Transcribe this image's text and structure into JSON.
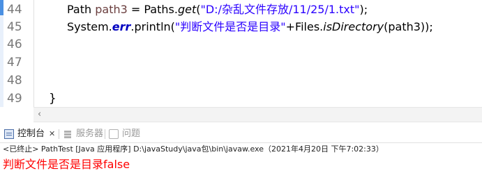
{
  "editor": {
    "line_numbers": [
      "44",
      "45",
      "46",
      "47",
      "48",
      "49"
    ],
    "line44": {
      "type": "Path ",
      "var": "path3",
      "eq": " = Paths.",
      "method": "get",
      "open": "(",
      "string": "\"D:/杂乱文件存放/11/25/1.txt\"",
      "close": ");"
    },
    "line45": {
      "prefix": "System.",
      "err": "err",
      "println": ".println(",
      "string": "\"判断文件是否是目录\"",
      "plus": "+Files.",
      "method": "isDirectory",
      "arg": "(path3));"
    },
    "closing_brace": "}"
  },
  "scrollbar": {
    "left_arrow": "‹"
  },
  "tabs": [
    {
      "label": "控制台",
      "close": "✕",
      "icon": "console-icon"
    },
    {
      "label": "服务器",
      "icon": "server-icon"
    },
    {
      "label": "问题",
      "icon": "problems-icon"
    }
  ],
  "console": {
    "status_line": "<已终止> PathTest [Java 应用程序] D:\\javaStudy\\java包\\bin\\javaw.exe（2021年4月20日 下午7:02:33）",
    "output": "判断文件是否是目录false"
  },
  "colors": {
    "string": "#2a00ff",
    "variable": "#6a3e3e",
    "field": "#0000c0",
    "stderr_output": "#ff0000"
  }
}
